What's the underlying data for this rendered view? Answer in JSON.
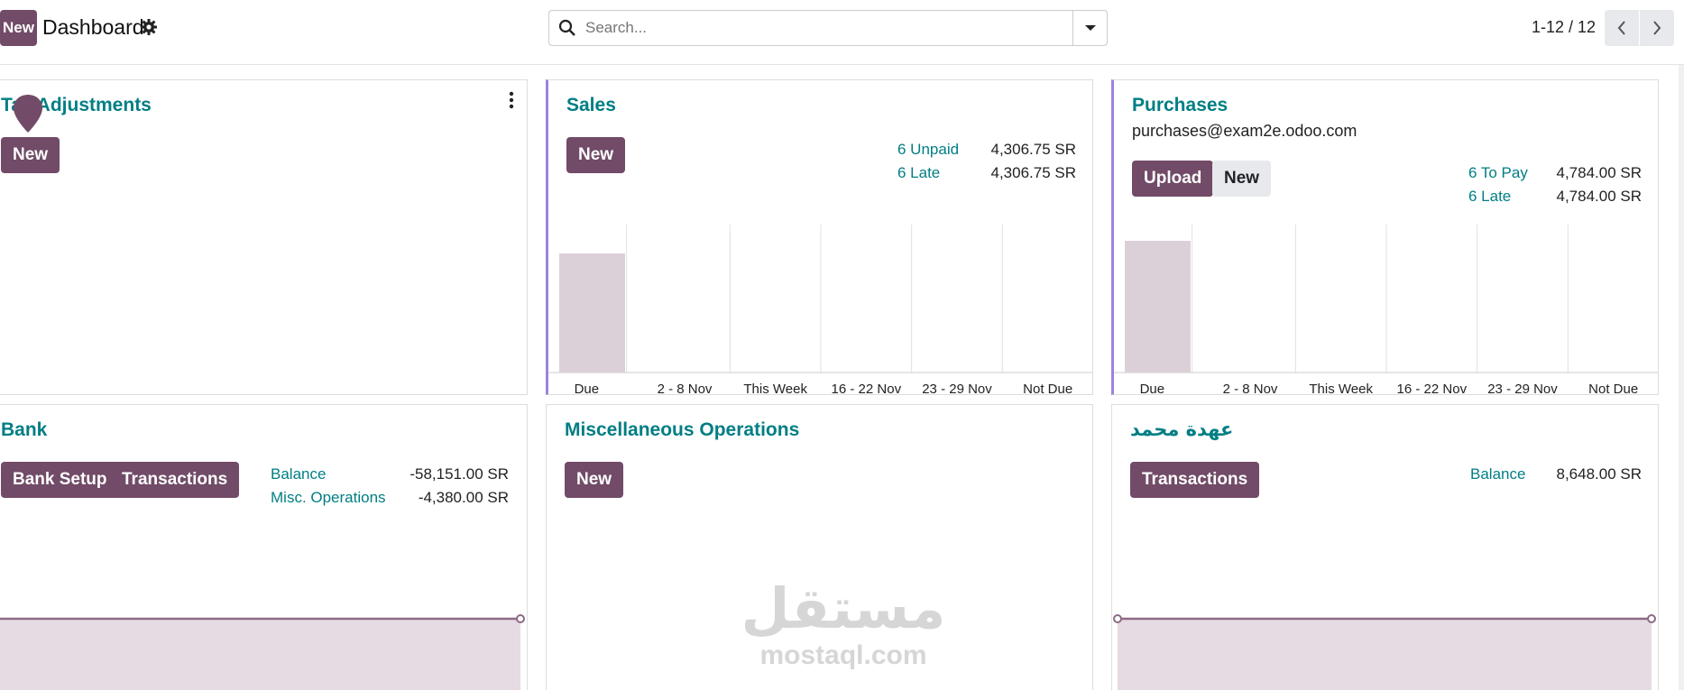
{
  "header": {
    "new_label": "New",
    "title": "Dashboard",
    "search_placeholder": "Search...",
    "pager": "1-12 / 12"
  },
  "cards": {
    "tax": {
      "title": "Tax Adjustments",
      "new_label": "New"
    },
    "sales": {
      "title": "Sales",
      "new_label": "New",
      "stats": [
        {
          "label": "6 Unpaid",
          "value": "4,306.75 SR"
        },
        {
          "label": "6 Late",
          "value": "4,306.75 SR"
        }
      ],
      "chart_data": {
        "type": "bar",
        "categories": [
          "Due",
          "2 - 8 Nov",
          "This Week",
          "16 - 22 Nov",
          "23 - 29 Nov",
          "Not Due"
        ],
        "values": [
          4306.75,
          0,
          0,
          0,
          0,
          0
        ]
      }
    },
    "purchases": {
      "title": "Purchases",
      "email": "purchases@exam2e.odoo.com",
      "upload_label": "Upload",
      "new_label": "New",
      "stats": [
        {
          "label": "6 To Pay",
          "value": "4,784.00 SR"
        },
        {
          "label": "6 Late",
          "value": "4,784.00 SR"
        }
      ],
      "chart_data": {
        "type": "bar",
        "categories": [
          "Due",
          "2 - 8 Nov",
          "This Week",
          "16 - 22 Nov",
          "23 - 29 Nov",
          "Not Due"
        ],
        "values": [
          4784,
          0,
          0,
          0,
          0,
          0
        ]
      }
    },
    "bank": {
      "title": "Bank",
      "setup_label": "Bank Setup",
      "transactions_label": "Transactions",
      "stats": [
        {
          "label": "Balance",
          "value": "-58,151.00 SR"
        },
        {
          "label": "Misc. Operations",
          "value": "-4,380.00 SR"
        }
      ]
    },
    "misc": {
      "title": "Miscellaneous Operations",
      "new_label": "New"
    },
    "custody": {
      "title": "عهدة محمد",
      "transactions_label": "Transactions",
      "stats": [
        {
          "label": "Balance",
          "value": "8,648.00 SR"
        }
      ]
    }
  },
  "watermark": {
    "arabic": "مستقل",
    "latin": "mostaql.com"
  },
  "colors": {
    "primary": "#714b67",
    "title_teal": "#017e84",
    "bar_fill": "#dcd0d8",
    "accent_border": "#9b85d8"
  }
}
